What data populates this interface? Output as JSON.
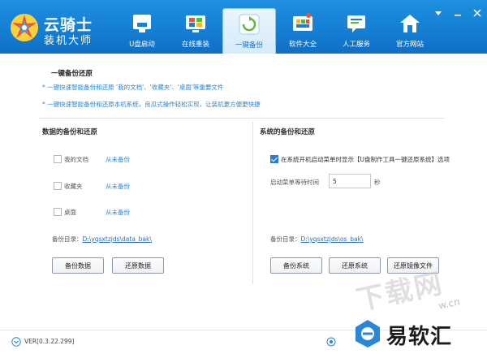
{
  "app": {
    "title": "云骑士",
    "subtitle": "装机大师"
  },
  "nav": {
    "items": [
      {
        "label": "U盘启动",
        "icon": "usb-icon"
      },
      {
        "label": "在线重装",
        "icon": "windows-icon"
      },
      {
        "label": "一键备份",
        "icon": "refresh-icon",
        "active": true
      },
      {
        "label": "软件大全",
        "icon": "software-icon"
      },
      {
        "label": "人工服务",
        "icon": "chat-icon"
      },
      {
        "label": "官方网站",
        "icon": "home-icon"
      }
    ]
  },
  "main": {
    "section_title": "一键备份还原",
    "tips": [
      "* 一键快速智能备份和还原 '我的文档'、'收藏夹'、'桌面'等重要文件",
      "* 一键快速智能备份和还原本机系统，良瓜式操作轻松实现，让装机更方便更快捷"
    ]
  },
  "data_panel": {
    "title": "数据的备份和还原",
    "items": [
      {
        "label": "我的文档",
        "status": "从未备份",
        "checked": false
      },
      {
        "label": "收藏夹",
        "status": "从未备份",
        "checked": false
      },
      {
        "label": "桌面",
        "status": "从未备份",
        "checked": false
      }
    ],
    "dir_label": "备份目录：",
    "dir_path": "D:\\yqsxtzjds\\data_bak\\",
    "backup_button": "备份数据",
    "restore_button": "还原数据"
  },
  "system_panel": {
    "title": "系统的备份和还原",
    "boot_option": "在系统开机启动菜单时显示【U盘制作工具一键还原系统】选项",
    "boot_option_checked": true,
    "wait_label": "启动菜单等待时间",
    "wait_value": "5",
    "wait_unit": "秒",
    "dir_label": "备份目录：",
    "dir_path": "D:\\yqsxtzjds\\os_bak\\",
    "backup_button": "备份系统",
    "restore_button": "还原系统",
    "restore_image_button": "还原镜像文件"
  },
  "footer": {
    "version": "VER[0.3.22.299]"
  },
  "watermark": {
    "large": "下载网",
    "domain": "w.cn",
    "brand": "易软汇"
  },
  "colors": {
    "header": "#1580d4",
    "accent": "#2a86d6",
    "link": "#2a6fb8"
  }
}
